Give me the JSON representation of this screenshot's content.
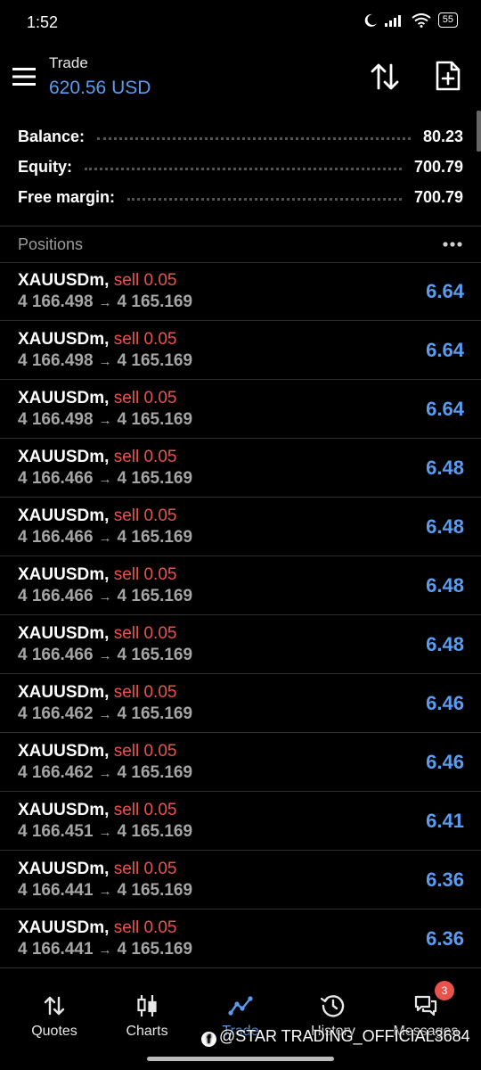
{
  "status": {
    "time": "1:52",
    "battery": "55"
  },
  "header": {
    "title": "Trade",
    "balance": "620.56 USD"
  },
  "summary": [
    {
      "label": "Balance:",
      "value": "80.23"
    },
    {
      "label": "Equity:",
      "value": "700.79"
    },
    {
      "label": "Free margin:",
      "value": "700.79"
    }
  ],
  "positions": {
    "title": "Positions",
    "items": [
      {
        "symbol": "XAUUSDm,",
        "side": "sell 0.05",
        "open": "4 166.498",
        "current": "4 165.169",
        "profit": "6.64"
      },
      {
        "symbol": "XAUUSDm,",
        "side": "sell 0.05",
        "open": "4 166.498",
        "current": "4 165.169",
        "profit": "6.64"
      },
      {
        "symbol": "XAUUSDm,",
        "side": "sell 0.05",
        "open": "4 166.498",
        "current": "4 165.169",
        "profit": "6.64"
      },
      {
        "symbol": "XAUUSDm,",
        "side": "sell 0.05",
        "open": "4 166.466",
        "current": "4 165.169",
        "profit": "6.48"
      },
      {
        "symbol": "XAUUSDm,",
        "side": "sell 0.05",
        "open": "4 166.466",
        "current": "4 165.169",
        "profit": "6.48"
      },
      {
        "symbol": "XAUUSDm,",
        "side": "sell 0.05",
        "open": "4 166.466",
        "current": "4 165.169",
        "profit": "6.48"
      },
      {
        "symbol": "XAUUSDm,",
        "side": "sell 0.05",
        "open": "4 166.466",
        "current": "4 165.169",
        "profit": "6.48"
      },
      {
        "symbol": "XAUUSDm,",
        "side": "sell 0.05",
        "open": "4 166.462",
        "current": "4 165.169",
        "profit": "6.46"
      },
      {
        "symbol": "XAUUSDm,",
        "side": "sell 0.05",
        "open": "4 166.462",
        "current": "4 165.169",
        "profit": "6.46"
      },
      {
        "symbol": "XAUUSDm,",
        "side": "sell 0.05",
        "open": "4 166.451",
        "current": "4 165.169",
        "profit": "6.41"
      },
      {
        "symbol": "XAUUSDm,",
        "side": "sell 0.05",
        "open": "4 166.441",
        "current": "4 165.169",
        "profit": "6.36"
      },
      {
        "symbol": "XAUUSDm,",
        "side": "sell 0.05",
        "open": "4 166.441",
        "current": "4 165.169",
        "profit": "6.36"
      }
    ]
  },
  "nav": {
    "quotes": "Quotes",
    "charts": "Charts",
    "trade": "Trade",
    "history": "History",
    "messages": "Messages",
    "messages_badge": "3"
  },
  "watermark": "@STAR TRADING_OFFICIAL3684",
  "colors": {
    "accent": "#5b9cf0",
    "sell": "#e9534c",
    "background": "#000000",
    "muted": "#a5a5a5"
  },
  "icons": [
    "menu-icon",
    "sort-icon",
    "new-order-icon",
    "more-icon",
    "quotes-icon",
    "charts-icon",
    "trade-icon",
    "history-icon",
    "messages-icon"
  ]
}
